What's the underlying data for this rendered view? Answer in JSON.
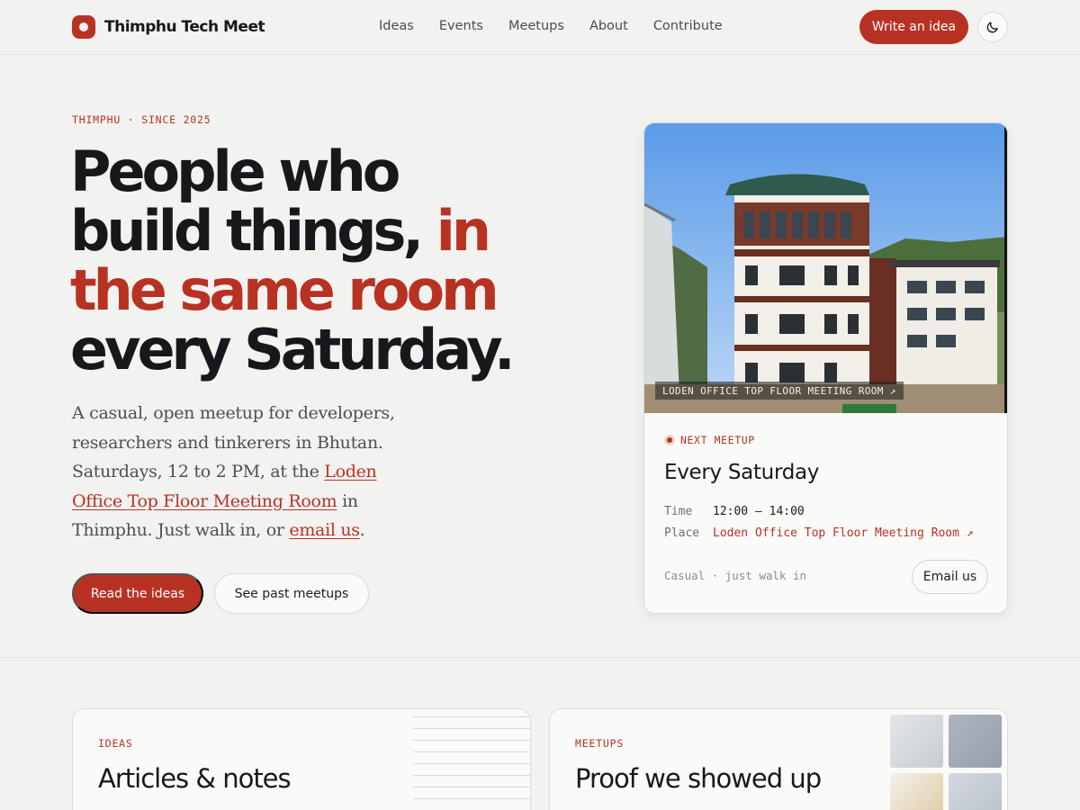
{
  "nav": {
    "brand": "Thimphu Tech Meet",
    "links": [
      "Ideas",
      "Events",
      "Meetups",
      "About",
      "Contribute"
    ],
    "cta": "Write an idea",
    "theme_icon": "moon-icon"
  },
  "hero": {
    "eyebrow": "THIMPHU · SINCE 2025",
    "headline_1": "People who",
    "headline_2": "build things,",
    "headline_accent": "in the same room",
    "headline_3": "every Saturday.",
    "lede_1": "A casual, open meetup for developers, researchers and tinkerers in Bhutan. Saturdays, 12 to 2 PM, at the ",
    "lede_link": "Loden Office Top Floor Meeting Room",
    "lede_2": " in Thimphu. Just walk in, or ",
    "lede_email": "email us",
    "lede_3": ".",
    "primary_button": "Read the ideas",
    "secondary_button": "See past meetups"
  },
  "meetup_card": {
    "photo_caption": "LODEN OFFICE TOP FLOOR MEETING ROOM ↗",
    "next_label": "NEXT MEETUP",
    "title": "Every Saturday",
    "time_label": "Time",
    "time_value": "12:00 – 14:00",
    "place_label": "Place",
    "place_value": "Loden Office Top Floor Meeting Room ↗",
    "note": "Casual · just walk in",
    "email_button": "Email us"
  },
  "features": [
    {
      "tag": "IDEAS",
      "title": "Articles & notes"
    },
    {
      "tag": "MEETUPS",
      "title": "Proof we showed up"
    }
  ],
  "colors": {
    "accent": "#b83224",
    "background": "#f2f2f0",
    "text": "#16181c"
  }
}
